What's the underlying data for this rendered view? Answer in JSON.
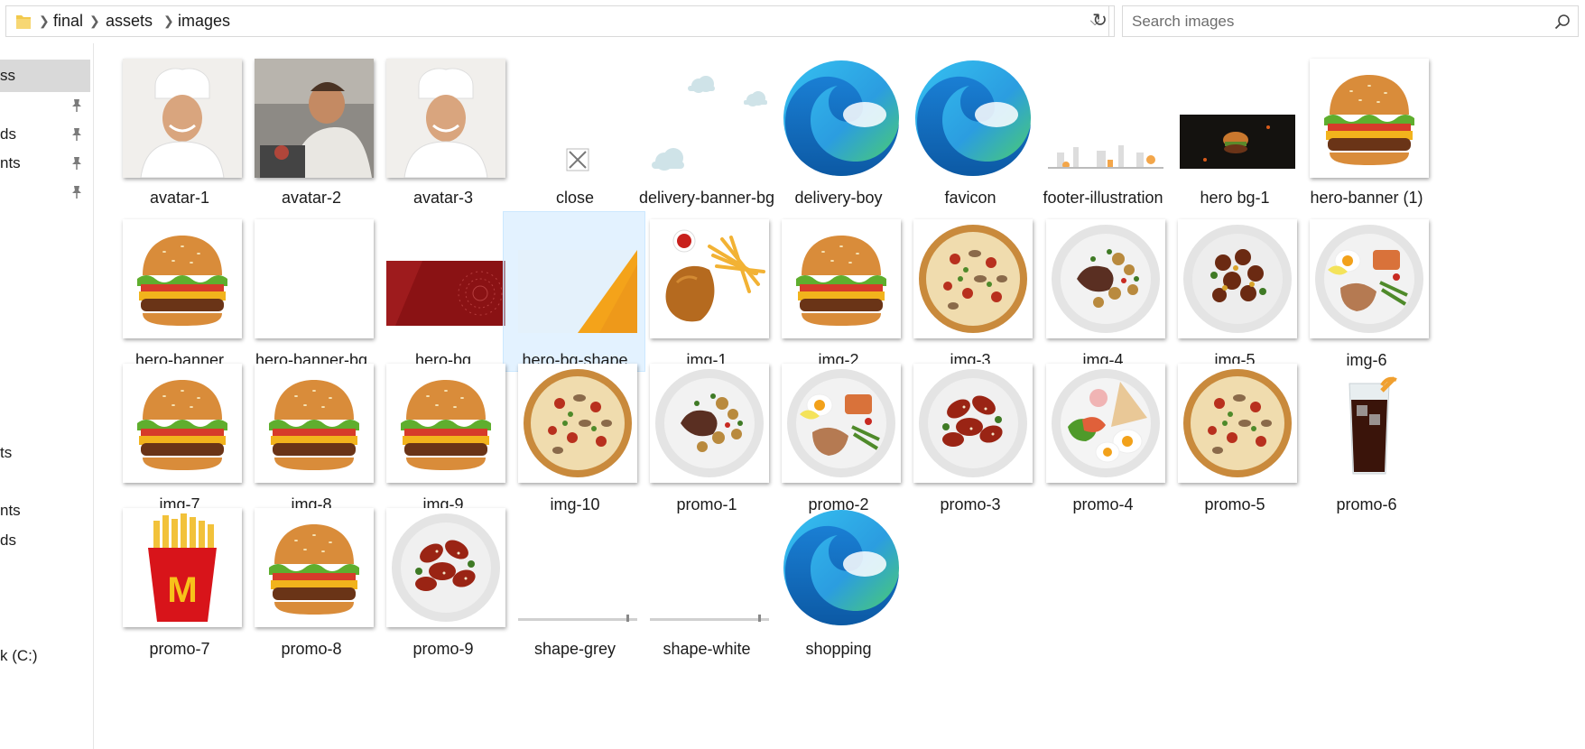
{
  "address": {
    "crumbs": [
      "final",
      "assets",
      "images"
    ]
  },
  "search": {
    "placeholder": "Search images"
  },
  "sidebar": {
    "items": [
      {
        "label": "ss",
        "pinned": false,
        "selected": true
      },
      {
        "label": "",
        "pinned": true
      },
      {
        "label": "ds",
        "pinned": true
      },
      {
        "label": "nts",
        "pinned": true
      },
      {
        "label": "",
        "pinned": true
      },
      {
        "label": "ts"
      },
      {
        "label": "nts"
      },
      {
        "label": "ds"
      },
      {
        "label": "k (C:)"
      }
    ]
  },
  "files": [
    {
      "name": "avatar-1",
      "icon": "chef-photo"
    },
    {
      "name": "avatar-2",
      "icon": "chef-cooking-photo"
    },
    {
      "name": "avatar-3",
      "icon": "chef-photo"
    },
    {
      "name": "close",
      "icon": "close-icon"
    },
    {
      "name": "delivery-banner-bg",
      "icon": "clouds-image"
    },
    {
      "name": "delivery-boy",
      "icon": "edge-icon"
    },
    {
      "name": "favicon",
      "icon": "edge-icon"
    },
    {
      "name": "footer-illustration",
      "icon": "city-illustration"
    },
    {
      "name": "hero bg-1",
      "icon": "burger-dark-image"
    },
    {
      "name": "hero-banner (1)",
      "icon": "burger-image"
    },
    {
      "name": "hero-banner",
      "icon": "burger-image"
    },
    {
      "name": "hero-banner-bg",
      "icon": "blank-image"
    },
    {
      "name": "hero-bg",
      "icon": "red-pattern-image"
    },
    {
      "name": "hero-bg-shape",
      "icon": "orange-shape-image",
      "selected": true
    },
    {
      "name": "img-1",
      "icon": "fried-chicken-image"
    },
    {
      "name": "img-2",
      "icon": "burger-image"
    },
    {
      "name": "img-3",
      "icon": "pizza-image"
    },
    {
      "name": "img-4",
      "icon": "steak-plate-image"
    },
    {
      "name": "img-5",
      "icon": "chicken-plate-image"
    },
    {
      "name": "img-6",
      "icon": "breakfast-plate-image"
    },
    {
      "name": "img-7",
      "icon": "burger-image"
    },
    {
      "name": "img-8",
      "icon": "burger-image"
    },
    {
      "name": "img-9",
      "icon": "burger-image"
    },
    {
      "name": "img-10",
      "icon": "pizza-image"
    },
    {
      "name": "promo-1",
      "icon": "steak-plate-image"
    },
    {
      "name": "promo-2",
      "icon": "breakfast-plate-image"
    },
    {
      "name": "promo-3",
      "icon": "wings-plate-image"
    },
    {
      "name": "promo-4",
      "icon": "egg-plate-image"
    },
    {
      "name": "promo-5",
      "icon": "pizza-image"
    },
    {
      "name": "promo-6",
      "icon": "cola-glass-image"
    },
    {
      "name": "promo-7",
      "icon": "fries-image"
    },
    {
      "name": "promo-8",
      "icon": "burger-image"
    },
    {
      "name": "promo-9",
      "icon": "wings-plate-image"
    },
    {
      "name": "shape-grey",
      "icon": "line-shape-image"
    },
    {
      "name": "shape-white",
      "icon": "line-shape-image"
    },
    {
      "name": "shopping",
      "icon": "edge-icon"
    }
  ],
  "colors": {
    "selection": "#cce8ff",
    "sidebar_selected": "#d9d9d9",
    "edge_blue": "#0c59a4",
    "edge_green": "#4fd35f"
  }
}
